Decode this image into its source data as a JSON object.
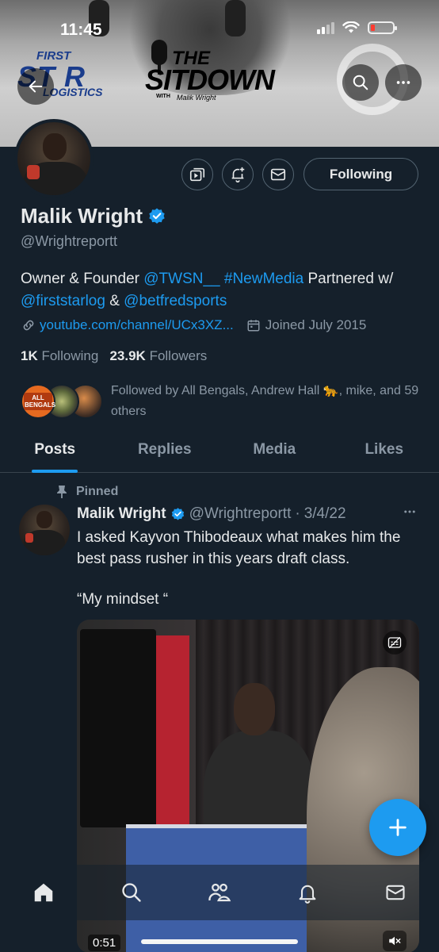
{
  "status_bar": {
    "time": "11:45"
  },
  "banner": {
    "logo_first_line1": "FIRST",
    "logo_first_line2": "ST R",
    "logo_first_line3": "LOGISTICS",
    "logo_sitdown_line1": "THE",
    "logo_sitdown_line2": "SITDOWN",
    "logo_sitdown_with": "WITH",
    "logo_sitdown_signature": "Malik Wright"
  },
  "profile": {
    "name": "Malik Wright",
    "handle": "@Wrightreportt",
    "follow_button": "Following",
    "bio": {
      "p1": "Owner & Founder ",
      "mention1": "@TWSN__",
      "p2": " ",
      "hashtag": "#NewMedia",
      "p3": " Partnered w/ ",
      "mention2": "@firststarlog",
      "p4": " & ",
      "mention3": "@betfredsports"
    },
    "link": "youtube.com/channel/UCx3XZ...",
    "joined": "Joined July 2015",
    "following_count": "1K",
    "following_label": "Following",
    "followers_count": "23.9K",
    "followers_label": "Followers",
    "followed_by": "Followed by All Bengals, Andrew Hall 🐆, mike, and 59 others",
    "mini_avatar_label": "ALL BENGALS"
  },
  "tabs": [
    {
      "label": "Posts",
      "active": true
    },
    {
      "label": "Replies",
      "active": false
    },
    {
      "label": "Media",
      "active": false
    },
    {
      "label": "Likes",
      "active": false
    }
  ],
  "post": {
    "pinned_label": "Pinned",
    "author_name": "Malik Wright",
    "author_handle": "@Wrightreportt",
    "separator": "·",
    "date": "3/4/22",
    "text_line1": "I asked Kayvon Thibodeaux what makes him the best pass rusher in this years draft class.",
    "text_line2": "“My mindset “",
    "video_duration": "0:51"
  },
  "colors": {
    "background": "#15202b",
    "accent": "#1d9bf0",
    "text_primary": "#e7e9ea",
    "text_secondary": "#8b98a5",
    "border": "#536471"
  },
  "icons": {
    "back": "arrow-left-icon",
    "search": "search-icon",
    "more": "more-horizontal-icon",
    "subscriptions": "subscriptions-icon",
    "notify": "bell-plus-icon",
    "message": "mail-icon",
    "verified": "verified-badge-icon",
    "link": "link-icon",
    "calendar": "calendar-icon",
    "pin": "pin-icon",
    "compose": "plus-icon",
    "home": "home-icon",
    "communities": "people-icon",
    "notifications": "bell-icon",
    "messages": "mail-icon"
  }
}
